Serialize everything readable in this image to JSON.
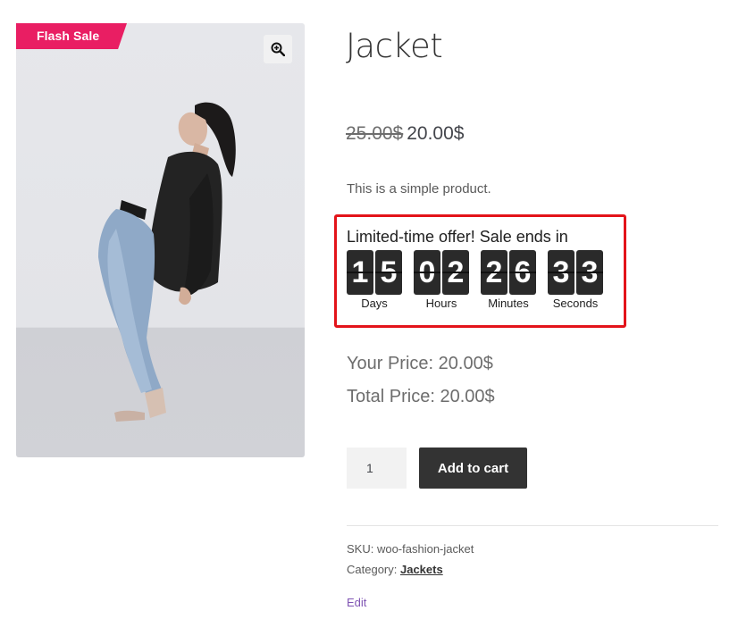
{
  "badge": {
    "label": "Flash Sale",
    "color": "#e91e63"
  },
  "zoom": {
    "icon": "zoom-in-icon"
  },
  "product": {
    "title": "Jacket",
    "old_price": "25.00$",
    "price": "20.00$",
    "short_description": "This is a simple product."
  },
  "countdown": {
    "title": "Limited-time offer! Sale ends in",
    "border_color": "#e3141a",
    "units": [
      {
        "label": "Days",
        "d1": "1",
        "d2": "5"
      },
      {
        "label": "Hours",
        "d1": "0",
        "d2": "2"
      },
      {
        "label": "Minutes",
        "d1": "2",
        "d2": "6"
      },
      {
        "label": "Seconds",
        "d1": "3",
        "d2": "3"
      }
    ]
  },
  "pricing": {
    "your_price": "Your Price: 20.00$",
    "total_price": "Total Price: 20.00$"
  },
  "cart": {
    "quantity": "1",
    "add_label": "Add to cart"
  },
  "meta": {
    "sku": "SKU: woo-fashion-jacket",
    "category_label": "Category: ",
    "category_link": "Jackets",
    "edit": "Edit"
  }
}
